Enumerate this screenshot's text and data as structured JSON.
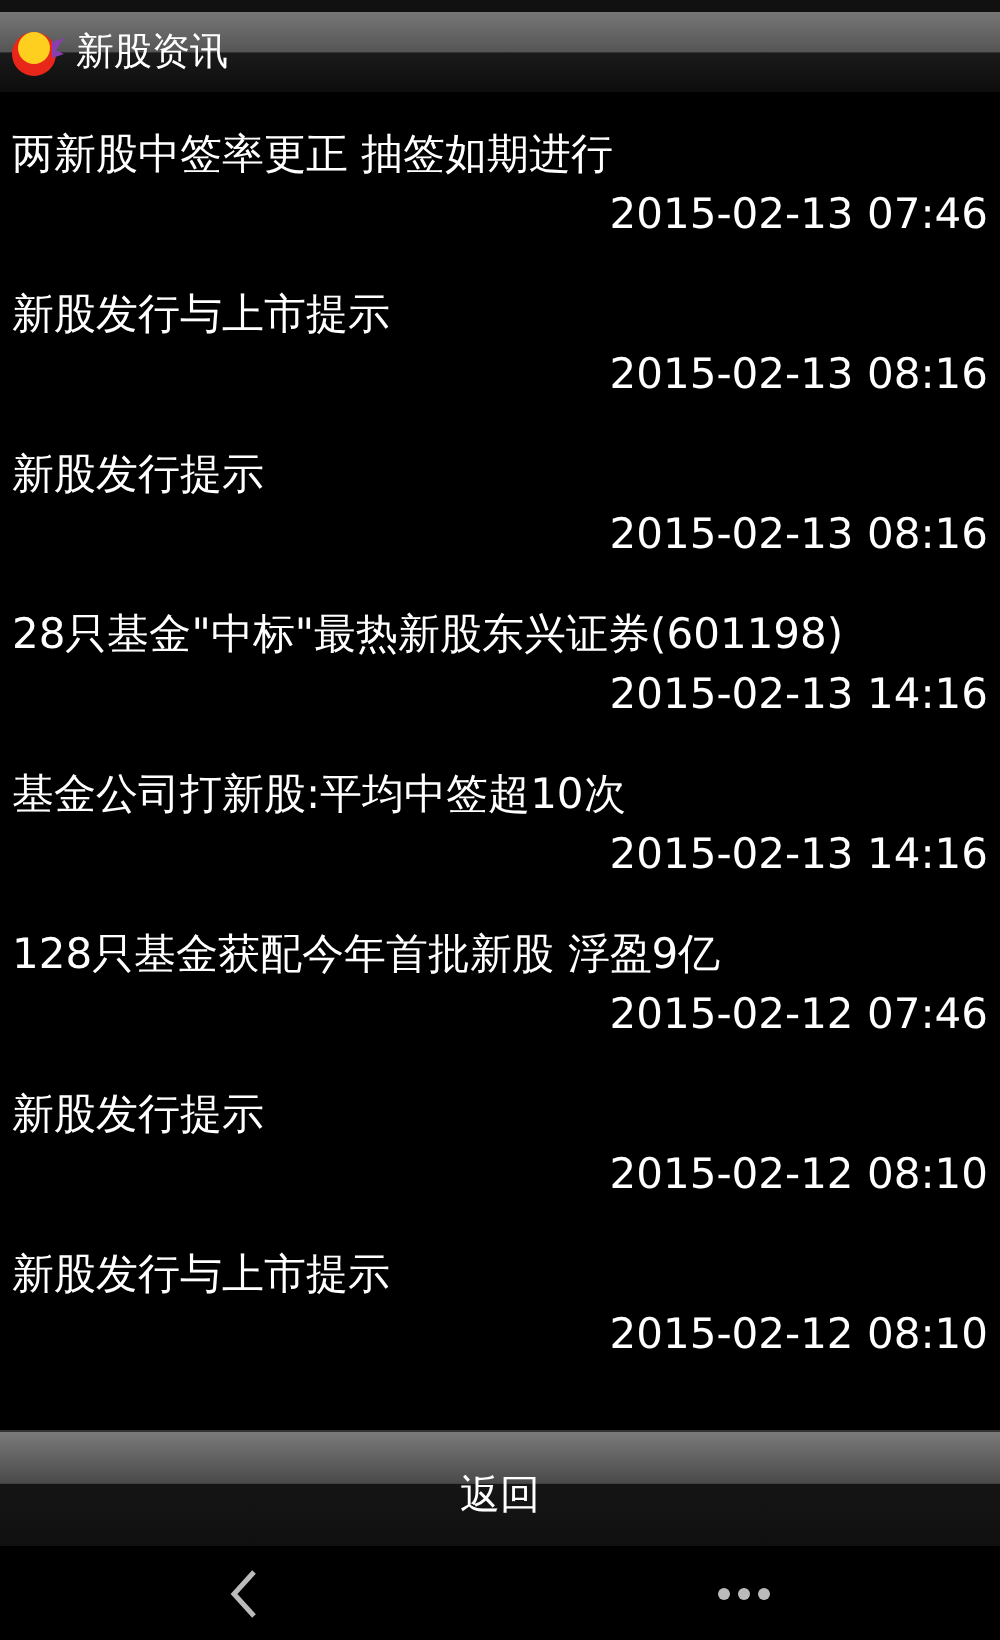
{
  "header": {
    "title": "新股资讯"
  },
  "news": [
    {
      "title": "两新股中签率更正 抽签如期进行",
      "time": "2015-02-13 07:46"
    },
    {
      "title": "新股发行与上市提示",
      "time": "2015-02-13 08:16"
    },
    {
      "title": "新股发行提示",
      "time": "2015-02-13 08:16"
    },
    {
      "title": "28只基金\"中标\"最热新股东兴证券(601198)",
      "time": "2015-02-13 14:16"
    },
    {
      "title": "基金公司打新股:平均中签超10次",
      "time": "2015-02-13 14:16"
    },
    {
      "title": "128只基金获配今年首批新股 浮盈9亿",
      "time": "2015-02-12 07:46"
    },
    {
      "title": "新股发行提示",
      "time": "2015-02-12 08:10"
    },
    {
      "title": "新股发行与上市提示",
      "time": "2015-02-12 08:10"
    }
  ],
  "back_button": "返回"
}
